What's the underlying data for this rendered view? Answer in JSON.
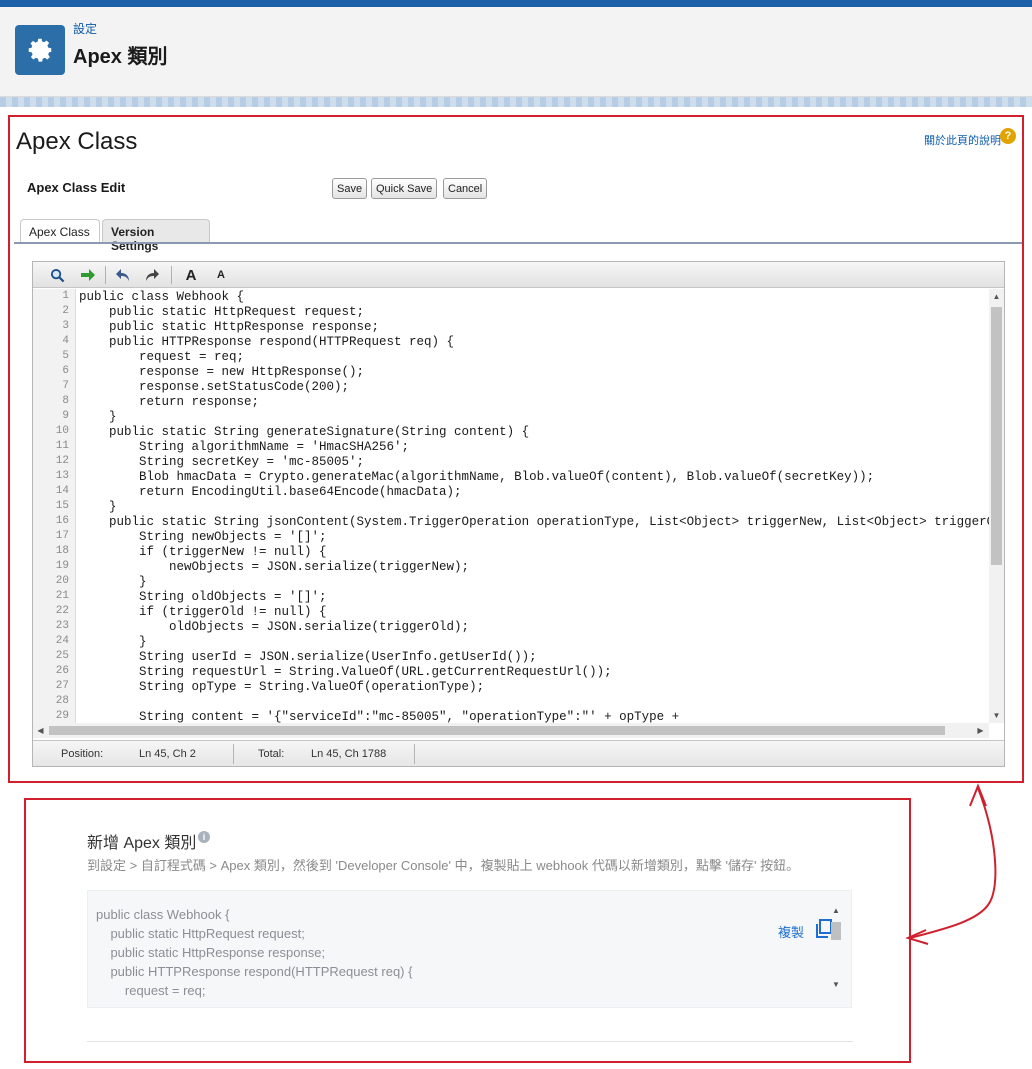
{
  "header": {
    "breadcrumb": "設定",
    "title": "Apex 類別",
    "icon": "gear-icon"
  },
  "page": {
    "title": "Apex Class",
    "help_link": "關於此頁的說明",
    "help_icon": "?"
  },
  "edit_section": {
    "title": "Apex Class Edit",
    "save_label": "Save",
    "quick_save_label": "Quick Save",
    "cancel_label": "Cancel"
  },
  "tabs": [
    {
      "label": "Apex Class",
      "active": true
    },
    {
      "label": "Version Settings",
      "active": false
    }
  ],
  "toolbar": {
    "font_increase": "A",
    "font_decrease": "A"
  },
  "code_lines": [
    "public class Webhook {",
    "    public static HttpRequest request;",
    "    public static HttpResponse response;",
    "    public HTTPResponse respond(HTTPRequest req) {",
    "        request = req;",
    "        response = new HttpResponse();",
    "        response.setStatusCode(200);",
    "        return response;",
    "    }",
    "    public static String generateSignature(String content) {",
    "        String algorithmName = 'HmacSHA256';",
    "        String secretKey = 'mc-85005';",
    "        Blob hmacData = Crypto.generateMac(algorithmName, Blob.valueOf(content), Blob.valueOf(secretKey));",
    "        return EncodingUtil.base64Encode(hmacData);",
    "    }",
    "    public static String jsonContent(System.TriggerOperation operationType, List<Object> triggerNew, List<Object> triggerOld",
    "        String newObjects = '[]';",
    "        if (triggerNew != null) {",
    "            newObjects = JSON.serialize(triggerNew);",
    "        }",
    "        String oldObjects = '[]';",
    "        if (triggerOld != null) {",
    "            oldObjects = JSON.serialize(triggerOld);",
    "        }",
    "        String userId = JSON.serialize(UserInfo.getUserId());",
    "        String requestUrl = String.ValueOf(URL.getCurrentRequestUrl());",
    "        String opType = String.ValueOf(operationType);",
    "",
    "        String content = '{\"serviceId\":\"mc-85005\", \"operationType\":\"' + opType +"
  ],
  "line_numbers": [
    "1",
    "2",
    "3",
    "4",
    "5",
    "6",
    "7",
    "8",
    "9",
    "10",
    "11",
    "12",
    "13",
    "14",
    "15",
    "16",
    "17",
    "18",
    "19",
    "20",
    "21",
    "22",
    "23",
    "24",
    "25",
    "26",
    "27",
    "28",
    "29"
  ],
  "status_bar": {
    "position_label": "Position:",
    "position_value": "Ln 45, Ch 2",
    "total_label": "Total:",
    "total_value": "Ln 45, Ch 1788"
  },
  "add_section": {
    "title": "新增 Apex 類別",
    "description": "到設定 > 自訂程式碼 > Apex 類別，然後到 'Developer Console' 中，複製貼上 webhook 代碼以新增類別，點擊 '儲存' 按鈕。",
    "copy_label": "複製",
    "snippet_lines": [
      "public class Webhook {",
      "    public static HttpRequest request;",
      "    public static HttpResponse response;",
      "    public HTTPResponse respond(HTTPRequest req) {",
      "        request = req;"
    ]
  },
  "colors": {
    "annotation_red": "#d0202d",
    "link_blue": "#0b5cab",
    "header_icon_bg": "#2b6ea8"
  }
}
